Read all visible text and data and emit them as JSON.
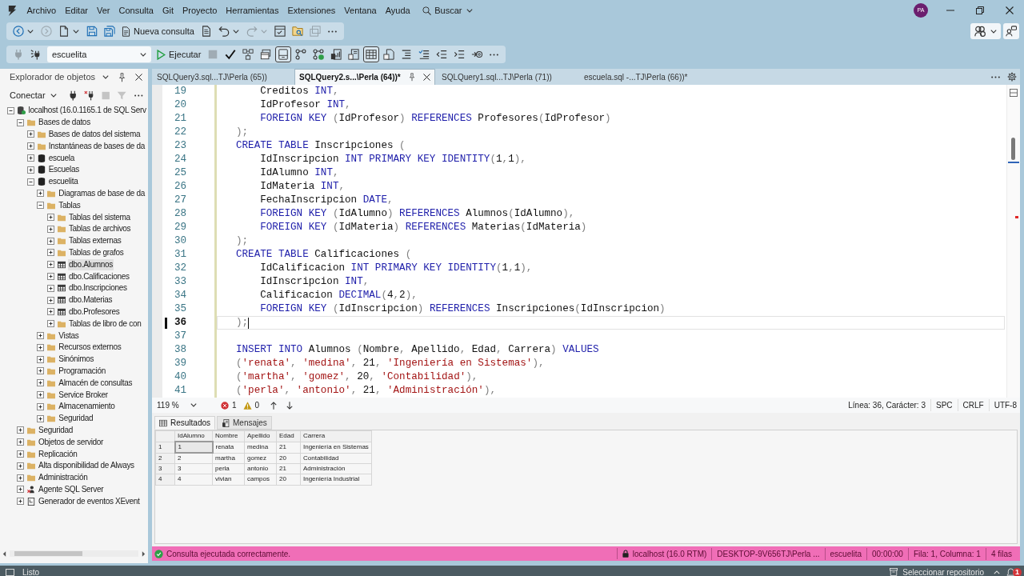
{
  "title_bar": {
    "menu": [
      "Archivo",
      "Editar",
      "Ver",
      "Consulta",
      "Git",
      "Proyecto",
      "Herramientas",
      "Extensiones",
      "Ventana",
      "Ayuda"
    ],
    "search_label": "Buscar",
    "avatar_initials": "PA"
  },
  "toolbar_1": [
    {
      "kind": "icon",
      "disabled": false
    },
    {
      "kind": "caret",
      "disabled": false
    },
    {
      "kind": "icon",
      "disabled": true
    },
    {
      "kind": "icon",
      "disabled": false
    },
    {
      "kind": "caret",
      "disabled": false
    },
    {
      "kind": "icon",
      "disabled": false
    },
    {
      "kind": "icon",
      "disabled": false
    },
    {
      "kind": "labeled",
      "label": "Nueva consulta"
    },
    {
      "kind": "icon",
      "disabled": false
    },
    {
      "kind": "icon",
      "disabled": false
    },
    {
      "kind": "caret",
      "disabled": false
    },
    {
      "kind": "icon",
      "disabled": true
    },
    {
      "kind": "caret",
      "disabled": true
    },
    {
      "kind": "icon",
      "disabled": false
    },
    {
      "kind": "icon",
      "disabled": false
    },
    {
      "kind": "icon",
      "disabled": true
    },
    {
      "kind": "more"
    }
  ],
  "toolbar_2": [
    {
      "kind": "icon",
      "disabled": true
    },
    {
      "kind": "icon",
      "disabled": false
    },
    {
      "kind": "select",
      "value": "escuelita"
    },
    {
      "kind": "labeled",
      "label": "Ejecutar"
    },
    {
      "kind": "icon",
      "disabled": true
    },
    {
      "kind": "icon",
      "disabled": false
    },
    {
      "kind": "icon",
      "disabled": false
    },
    {
      "kind": "icon",
      "disabled": false
    },
    {
      "kind": "toggle",
      "pressed": true
    },
    {
      "kind": "icon",
      "disabled": false
    },
    {
      "kind": "icon",
      "disabled": false
    },
    {
      "kind": "icon",
      "disabled": false
    },
    {
      "kind": "icon",
      "disabled": false
    },
    {
      "kind": "toggle",
      "pressed": true
    },
    {
      "kind": "icon",
      "disabled": false
    },
    {
      "kind": "icon",
      "disabled": false
    },
    {
      "kind": "icon",
      "disabled": false
    },
    {
      "kind": "icon",
      "disabled": false
    },
    {
      "kind": "icon",
      "disabled": false
    },
    {
      "kind": "icon",
      "disabled": false
    },
    {
      "kind": "more"
    }
  ],
  "object_explorer": {
    "title": "Explorador de objetos",
    "connect_label": "Conectar",
    "tools": [
      {
        "disabled": false
      },
      {
        "disabled": false
      },
      {
        "disabled": true
      },
      {
        "disabled": true
      }
    ],
    "tree": [
      {
        "label": "localhost (16.0.1165.1 de SQL Serv",
        "kind": "server",
        "expanded": true,
        "selected": false,
        "children": [
          {
            "label": "Bases de datos",
            "kind": "folder",
            "expanded": true,
            "selected": false,
            "children": [
              {
                "label": "Bases de datos del sistema",
                "kind": "folder",
                "expanded": false,
                "selected": false
              },
              {
                "label": "Instantáneas de bases de da",
                "kind": "folder",
                "expanded": false,
                "selected": false
              },
              {
                "label": "escuela",
                "kind": "database",
                "expanded": false,
                "selected": false
              },
              {
                "label": "Escuelas",
                "kind": "database",
                "expanded": false,
                "selected": false
              },
              {
                "label": "escuelita",
                "kind": "database",
                "expanded": true,
                "selected": false,
                "children": [
                  {
                    "label": "Diagramas de base de da",
                    "kind": "folder",
                    "expanded": false,
                    "selected": false
                  },
                  {
                    "label": "Tablas",
                    "kind": "folder",
                    "expanded": true,
                    "selected": false,
                    "children": [
                      {
                        "label": "Tablas del sistema",
                        "kind": "folder",
                        "expanded": false,
                        "selected": false
                      },
                      {
                        "label": "Tablas de archivos",
                        "kind": "folder",
                        "expanded": false,
                        "selected": false
                      },
                      {
                        "label": "Tablas externas",
                        "kind": "folder",
                        "expanded": false,
                        "selected": false
                      },
                      {
                        "label": "Tablas de grafos",
                        "kind": "folder",
                        "expanded": false,
                        "selected": false
                      },
                      {
                        "label": "dbo.Alumnos",
                        "kind": "table",
                        "expanded": false,
                        "selected": true
                      },
                      {
                        "label": "dbo.Calificaciones",
                        "kind": "table",
                        "expanded": false,
                        "selected": false
                      },
                      {
                        "label": "dbo.Inscripciones",
                        "kind": "table",
                        "expanded": false,
                        "selected": false
                      },
                      {
                        "label": "dbo.Materias",
                        "kind": "table",
                        "expanded": false,
                        "selected": false
                      },
                      {
                        "label": "dbo.Profesores",
                        "kind": "table",
                        "expanded": false,
                        "selected": false
                      },
                      {
                        "label": "Tablas de libro de con",
                        "kind": "folder",
                        "expanded": false,
                        "selected": false
                      }
                    ]
                  },
                  {
                    "label": "Vistas",
                    "kind": "folder",
                    "expanded": false,
                    "selected": false
                  },
                  {
                    "label": "Recursos externos",
                    "kind": "folder",
                    "expanded": false,
                    "selected": false
                  },
                  {
                    "label": "Sinónimos",
                    "kind": "folder",
                    "expanded": false,
                    "selected": false
                  },
                  {
                    "label": "Programación",
                    "kind": "folder",
                    "expanded": false,
                    "selected": false
                  },
                  {
                    "label": "Almacén de consultas",
                    "kind": "folder",
                    "expanded": false,
                    "selected": false
                  },
                  {
                    "label": "Service Broker",
                    "kind": "folder",
                    "expanded": false,
                    "selected": false
                  },
                  {
                    "label": "Almacenamiento",
                    "kind": "folder",
                    "expanded": false,
                    "selected": false
                  },
                  {
                    "label": "Seguridad",
                    "kind": "folder",
                    "expanded": false,
                    "selected": false
                  }
                ]
              }
            ]
          },
          {
            "label": "Seguridad",
            "kind": "folder",
            "expanded": false,
            "selected": false
          },
          {
            "label": "Objetos de servidor",
            "kind": "folder",
            "expanded": false,
            "selected": false
          },
          {
            "label": "Replicación",
            "kind": "folder",
            "expanded": false,
            "selected": false
          },
          {
            "label": "Alta disponibilidad de Always",
            "kind": "folder",
            "expanded": false,
            "selected": false
          },
          {
            "label": "Administración",
            "kind": "folder",
            "expanded": false,
            "selected": false
          },
          {
            "label": "Agente SQL Server",
            "kind": "agent",
            "expanded": false,
            "selected": false
          },
          {
            "label": "Generador de eventos XEvent",
            "kind": "xevent",
            "expanded": false,
            "selected": false
          }
        ]
      }
    ]
  },
  "editor_tabs": [
    {
      "label": "SQLQuery3.sql...TJ\\Perla (65))",
      "selected": false
    },
    {
      "label": "SQLQuery2.s...\\Perla (64))*",
      "selected": true
    },
    {
      "label": "SQLQuery1.sql...TJ\\Perla (71))",
      "selected": false
    },
    {
      "label": "escuela.sql -...TJ\\Perla (66))*",
      "selected": false
    }
  ],
  "editor": {
    "lines": [
      {
        "number": "19",
        "current": false,
        "tokens": [
          {
            "kind": "identifier",
            "text": "    Creditos "
          },
          {
            "kind": "keyword",
            "text": "INT"
          },
          {
            "kind": "punctuation",
            "text": ","
          }
        ]
      },
      {
        "number": "20",
        "current": false,
        "tokens": [
          {
            "kind": "identifier",
            "text": "    IdProfesor "
          },
          {
            "kind": "keyword",
            "text": "INT"
          },
          {
            "kind": "punctuation",
            "text": ","
          }
        ]
      },
      {
        "number": "21",
        "current": false,
        "tokens": [
          {
            "kind": "keyword",
            "text": "    FOREIGN KEY "
          },
          {
            "kind": "punctuation",
            "text": "("
          },
          {
            "kind": "identifier",
            "text": "IdProfesor"
          },
          {
            "kind": "punctuation",
            "text": ") "
          },
          {
            "kind": "keyword",
            "text": "REFERENCES "
          },
          {
            "kind": "identifier",
            "text": "Profesores"
          },
          {
            "kind": "punctuation",
            "text": "("
          },
          {
            "kind": "identifier",
            "text": "IdProfesor"
          },
          {
            "kind": "punctuation",
            "text": ")"
          }
        ]
      },
      {
        "number": "22",
        "current": false,
        "tokens": [
          {
            "kind": "punctuation",
            "text": ");"
          }
        ]
      },
      {
        "number": "23",
        "current": false,
        "tokens": [
          {
            "kind": "keyword",
            "text": "CREATE TABLE "
          },
          {
            "kind": "identifier",
            "text": "Inscripciones "
          },
          {
            "kind": "punctuation",
            "text": "("
          }
        ]
      },
      {
        "number": "24",
        "current": false,
        "tokens": [
          {
            "kind": "identifier",
            "text": "    IdInscripcion "
          },
          {
            "kind": "keyword",
            "text": "INT PRIMARY KEY IDENTITY"
          },
          {
            "kind": "punctuation",
            "text": "("
          },
          {
            "kind": "number",
            "text": "1"
          },
          {
            "kind": "punctuation",
            "text": ","
          },
          {
            "kind": "number",
            "text": "1"
          },
          {
            "kind": "punctuation",
            "text": "),"
          }
        ]
      },
      {
        "number": "25",
        "current": false,
        "tokens": [
          {
            "kind": "identifier",
            "text": "    IdAlumno "
          },
          {
            "kind": "keyword",
            "text": "INT"
          },
          {
            "kind": "punctuation",
            "text": ","
          }
        ]
      },
      {
        "number": "26",
        "current": false,
        "tokens": [
          {
            "kind": "identifier",
            "text": "    IdMateria "
          },
          {
            "kind": "keyword",
            "text": "INT"
          },
          {
            "kind": "punctuation",
            "text": ","
          }
        ]
      },
      {
        "number": "27",
        "current": false,
        "tokens": [
          {
            "kind": "identifier",
            "text": "    FechaInscripcion "
          },
          {
            "kind": "keyword",
            "text": "DATE"
          },
          {
            "kind": "punctuation",
            "text": ","
          }
        ]
      },
      {
        "number": "28",
        "current": false,
        "tokens": [
          {
            "kind": "keyword",
            "text": "    FOREIGN KEY "
          },
          {
            "kind": "punctuation",
            "text": "("
          },
          {
            "kind": "identifier",
            "text": "IdAlumno"
          },
          {
            "kind": "punctuation",
            "text": ") "
          },
          {
            "kind": "keyword",
            "text": "REFERENCES "
          },
          {
            "kind": "identifier",
            "text": "Alumnos"
          },
          {
            "kind": "punctuation",
            "text": "("
          },
          {
            "kind": "identifier",
            "text": "IdAlumno"
          },
          {
            "kind": "punctuation",
            "text": "),"
          }
        ]
      },
      {
        "number": "29",
        "current": false,
        "tokens": [
          {
            "kind": "keyword",
            "text": "    FOREIGN KEY "
          },
          {
            "kind": "punctuation",
            "text": "("
          },
          {
            "kind": "identifier",
            "text": "IdMateria"
          },
          {
            "kind": "punctuation",
            "text": ") "
          },
          {
            "kind": "keyword",
            "text": "REFERENCES "
          },
          {
            "kind": "identifier",
            "text": "Materias"
          },
          {
            "kind": "punctuation",
            "text": "("
          },
          {
            "kind": "identifier",
            "text": "IdMateria"
          },
          {
            "kind": "punctuation",
            "text": ")"
          }
        ]
      },
      {
        "number": "30",
        "current": false,
        "tokens": [
          {
            "kind": "punctuation",
            "text": ");"
          }
        ]
      },
      {
        "number": "31",
        "current": false,
        "tokens": [
          {
            "kind": "keyword",
            "text": "CREATE TABLE "
          },
          {
            "kind": "identifier",
            "text": "Calificaciones "
          },
          {
            "kind": "punctuation",
            "text": "("
          }
        ]
      },
      {
        "number": "32",
        "current": false,
        "tokens": [
          {
            "kind": "identifier",
            "text": "    IdCalificacion "
          },
          {
            "kind": "keyword",
            "text": "INT PRIMARY KEY IDENTITY"
          },
          {
            "kind": "punctuation",
            "text": "("
          },
          {
            "kind": "number",
            "text": "1"
          },
          {
            "kind": "punctuation",
            "text": ","
          },
          {
            "kind": "number",
            "text": "1"
          },
          {
            "kind": "punctuation",
            "text": "),"
          }
        ]
      },
      {
        "number": "33",
        "current": false,
        "tokens": [
          {
            "kind": "identifier",
            "text": "    IdInscripcion "
          },
          {
            "kind": "keyword",
            "text": "INT"
          },
          {
            "kind": "punctuation",
            "text": ","
          }
        ]
      },
      {
        "number": "34",
        "current": false,
        "tokens": [
          {
            "kind": "identifier",
            "text": "    Calificacion "
          },
          {
            "kind": "keyword",
            "text": "DECIMAL"
          },
          {
            "kind": "punctuation",
            "text": "("
          },
          {
            "kind": "number",
            "text": "4"
          },
          {
            "kind": "punctuation",
            "text": ","
          },
          {
            "kind": "number",
            "text": "2"
          },
          {
            "kind": "punctuation",
            "text": "),"
          }
        ]
      },
      {
        "number": "35",
        "current": false,
        "tokens": [
          {
            "kind": "keyword",
            "text": "    FOREIGN KEY "
          },
          {
            "kind": "punctuation",
            "text": "("
          },
          {
            "kind": "identifier",
            "text": "IdInscripcion"
          },
          {
            "kind": "punctuation",
            "text": ") "
          },
          {
            "kind": "keyword",
            "text": "REFERENCES "
          },
          {
            "kind": "identifier",
            "text": "Inscripciones"
          },
          {
            "kind": "punctuation",
            "text": "("
          },
          {
            "kind": "identifier",
            "text": "IdInscripcion"
          },
          {
            "kind": "punctuation",
            "text": ")"
          }
        ]
      },
      {
        "number": "36",
        "current": true,
        "tokens": [
          {
            "kind": "punctuation",
            "text": ");"
          }
        ]
      },
      {
        "number": "37",
        "current": false
      },
      {
        "number": "38",
        "current": false,
        "tokens": [
          {
            "kind": "keyword",
            "text": "INSERT INTO "
          },
          {
            "kind": "identifier",
            "text": "Alumnos "
          },
          {
            "kind": "punctuation",
            "text": "("
          },
          {
            "kind": "identifier",
            "text": "Nombre"
          },
          {
            "kind": "punctuation",
            "text": ", "
          },
          {
            "kind": "identifier",
            "text": "Apellido"
          },
          {
            "kind": "punctuation",
            "text": ", "
          },
          {
            "kind": "identifier",
            "text": "Edad"
          },
          {
            "kind": "punctuation",
            "text": ", "
          },
          {
            "kind": "identifier",
            "text": "Carrera"
          },
          {
            "kind": "punctuation",
            "text": ") "
          },
          {
            "kind": "keyword",
            "text": "VALUES"
          }
        ]
      },
      {
        "number": "39",
        "current": false,
        "tokens": [
          {
            "kind": "punctuation",
            "text": "("
          },
          {
            "kind": "string",
            "text": "'renata'"
          },
          {
            "kind": "punctuation",
            "text": ", "
          },
          {
            "kind": "string",
            "text": "'medina'"
          },
          {
            "kind": "punctuation",
            "text": ", "
          },
          {
            "kind": "number",
            "text": "21"
          },
          {
            "kind": "punctuation",
            "text": ", "
          },
          {
            "kind": "string",
            "text": "'Ingeniería en Sistemas'"
          },
          {
            "kind": "punctuation",
            "text": "),"
          }
        ]
      },
      {
        "number": "40",
        "current": false,
        "tokens": [
          {
            "kind": "punctuation",
            "text": "("
          },
          {
            "kind": "string",
            "text": "'martha'"
          },
          {
            "kind": "punctuation",
            "text": ", "
          },
          {
            "kind": "string",
            "text": "'gomez'"
          },
          {
            "kind": "punctuation",
            "text": ", "
          },
          {
            "kind": "number",
            "text": "20"
          },
          {
            "kind": "punctuation",
            "text": ", "
          },
          {
            "kind": "string",
            "text": "'Contabilidad'"
          },
          {
            "kind": "punctuation",
            "text": "),"
          }
        ]
      },
      {
        "number": "41",
        "current": false,
        "tokens": [
          {
            "kind": "punctuation",
            "text": "("
          },
          {
            "kind": "string",
            "text": "'perla'"
          },
          {
            "kind": "punctuation",
            "text": ", "
          },
          {
            "kind": "string",
            "text": "'antonio'"
          },
          {
            "kind": "punctuation",
            "text": ", "
          },
          {
            "kind": "number",
            "text": "21"
          },
          {
            "kind": "punctuation",
            "text": ", "
          },
          {
            "kind": "string",
            "text": "'Administración'"
          },
          {
            "kind": "punctuation",
            "text": "),"
          }
        ]
      }
    ]
  },
  "editor_status": {
    "zoom": "119 %",
    "errors": "1",
    "warnings": "0",
    "position": "Línea: 36, Carácter: 3",
    "indentation": "SPC",
    "line_endings": "CRLF",
    "encoding": "UTF-8"
  },
  "results": {
    "tabs": [
      {
        "label": "Resultados",
        "selected": true
      },
      {
        "label": "Mensajes",
        "selected": false
      }
    ],
    "columns": [
      "IdAlumno",
      "Nombre",
      "Apellido",
      "Edad",
      "Carrera"
    ],
    "rows": [
      {
        "number": "1",
        "cells": [
          {
            "text": "1",
            "selected": true
          },
          {
            "text": "renata",
            "selected": false
          },
          {
            "text": "medina",
            "selected": false
          },
          {
            "text": "21",
            "selected": false
          },
          {
            "text": "Ingeniería en Sistemas",
            "selected": false
          }
        ]
      },
      {
        "number": "2",
        "cells": [
          {
            "text": "2",
            "selected": false
          },
          {
            "text": "martha",
            "selected": false
          },
          {
            "text": "gomez",
            "selected": false
          },
          {
            "text": "20",
            "selected": false
          },
          {
            "text": "Contabilidad",
            "selected": false
          }
        ]
      },
      {
        "number": "3",
        "cells": [
          {
            "text": "3",
            "selected": false
          },
          {
            "text": "perla",
            "selected": false
          },
          {
            "text": "antonio",
            "selected": false
          },
          {
            "text": "21",
            "selected": false
          },
          {
            "text": "Administración",
            "selected": false
          }
        ]
      },
      {
        "number": "4",
        "cells": [
          {
            "text": "4",
            "selected": false
          },
          {
            "text": "vivian",
            "selected": false
          },
          {
            "text": "campos",
            "selected": false
          },
          {
            "text": "20",
            "selected": false
          },
          {
            "text": "Ingeniería Industrial",
            "selected": false
          }
        ]
      }
    ]
  },
  "status_bar": {
    "message": "Consulta ejecutada correctamente.",
    "server": "localhost (16.0 RTM)",
    "user": "DESKTOP-9V656TJ\\Perla ...",
    "database": "escuelita",
    "elapsed": "00:00:00",
    "cursor": "Fila: 1, Columna: 1",
    "row_count": "4 filas"
  },
  "app_status": {
    "text": "Listo",
    "repository": "Seleccionar repositorio",
    "notifications": "1"
  }
}
